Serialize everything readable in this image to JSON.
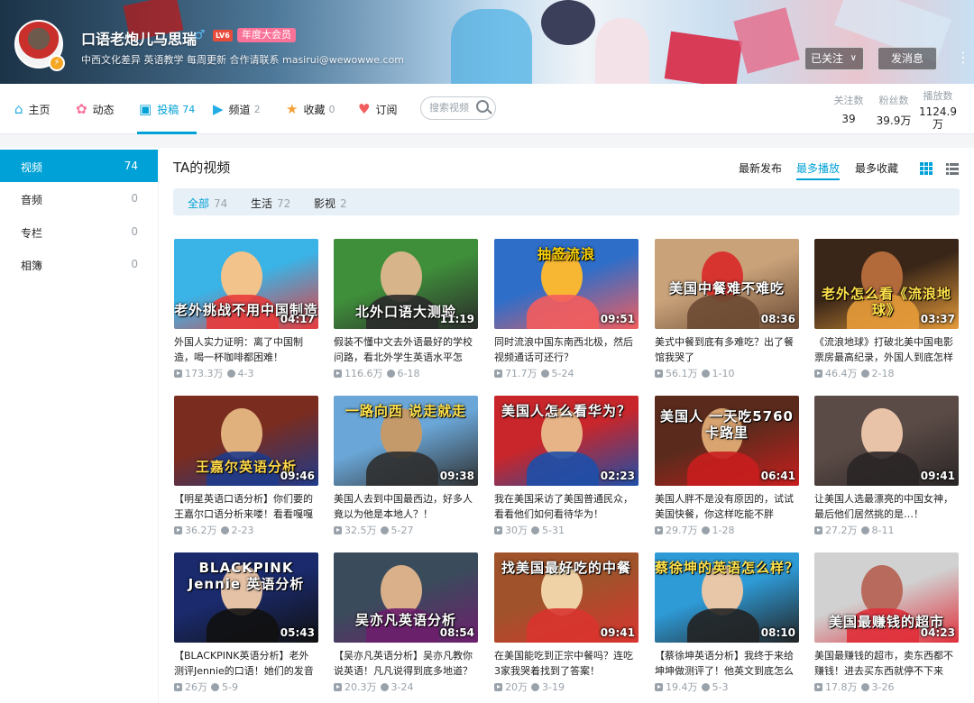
{
  "colors": {
    "accent": "#00a1d6",
    "vip": "#fb7299",
    "muted": "#99a2aa"
  },
  "header": {
    "username": "口语老炮儿马思瑞",
    "gender_icon": "male-icon",
    "level_badge": "LV6",
    "vip_badge": "年度大会员",
    "signature": "中西文化差异 英语教学 每周更新 合作请联系 masirui@wewowwe.com",
    "follow_button": "已关注",
    "message_button": "发消息",
    "more_icon": "more-vertical-icon"
  },
  "nav": {
    "items": [
      {
        "label": "主页",
        "count": "",
        "icon": "home-icon"
      },
      {
        "label": "动态",
        "count": "",
        "icon": "flower-icon"
      },
      {
        "label": "投稿",
        "count": "74",
        "icon": "video-icon"
      },
      {
        "label": "频道",
        "count": "2",
        "icon": "channel-icon"
      },
      {
        "label": "收藏",
        "count": "0",
        "icon": "star-icon"
      },
      {
        "label": "订阅",
        "count": "",
        "icon": "heart-icon"
      }
    ],
    "search_placeholder": "搜索视频",
    "stats": [
      {
        "label": "关注数",
        "value": "39"
      },
      {
        "label": "粉丝数",
        "value": "39.9万"
      },
      {
        "label": "播放数",
        "value": "1124.9万"
      }
    ]
  },
  "sidebar": {
    "items": [
      {
        "label": "视频",
        "count": "74"
      },
      {
        "label": "音频",
        "count": "0"
      },
      {
        "label": "专栏",
        "count": "0"
      },
      {
        "label": "相簿",
        "count": "0"
      }
    ]
  },
  "main": {
    "title": "TA的视频",
    "sort": [
      "最新发布",
      "最多播放",
      "最多收藏"
    ],
    "filters": [
      {
        "label": "全部",
        "count": "74"
      },
      {
        "label": "生活",
        "count": "72"
      },
      {
        "label": "影视",
        "count": "2"
      }
    ]
  },
  "videos": [
    {
      "overlay": "老外挑战不用中国制造",
      "duration": "04:17",
      "title": "外国人实力证明：离了中国制造，喝一杯咖啡都困难！",
      "views": "173.3万",
      "date": "4-3"
    },
    {
      "overlay": "北外口语大测验",
      "duration": "11:19",
      "title": "假装不懂中文去外语最好的学校问路，看北外学生英语水平怎",
      "views": "116.6万",
      "date": "6-18"
    },
    {
      "overlay": "抽签流浪",
      "duration": "09:51",
      "title": "同时流浪中国东南西北极，然后视频通话可还行？",
      "views": "71.7万",
      "date": "5-24"
    },
    {
      "overlay": "美国中餐难不难吃",
      "duration": "08:36",
      "title": "美式中餐到底有多难吃？出了餐馆我哭了",
      "views": "56.1万",
      "date": "1-10"
    },
    {
      "overlay": "老外怎么看《流浪地球》",
      "duration": "03:37",
      "title": "《流浪地球》打破北美中国电影票房最高纪录，外国人到底怎样",
      "views": "46.4万",
      "date": "2-18"
    },
    {
      "overlay": "王嘉尔英语分析",
      "duration": "09:46",
      "title": "【明星英语口语分析】你们要的王嘉尔口语分析来喽！看看嘎嘎",
      "views": "36.2万",
      "date": "2-23"
    },
    {
      "overlay": "一路向西 说走就走",
      "duration": "09:38",
      "title": "美国人去到中国最西边，好多人竟以为他是本地人？！",
      "views": "32.5万",
      "date": "5-27"
    },
    {
      "overlay": "美国人怎么看华为？",
      "duration": "02:23",
      "title": "我在美国采访了美国普通民众，看看他们如何看待华为！",
      "views": "30万",
      "date": "5-31"
    },
    {
      "overlay": "美国人 一天吃5760卡路里",
      "duration": "06:41",
      "title": "美国人胖不是没有原因的，试试美国快餐，你这样吃能不胖",
      "views": "29.7万",
      "date": "1-28"
    },
    {
      "overlay": "",
      "duration": "09:41",
      "title": "让美国人选最漂亮的中国女神，最后他们居然挑的是…！",
      "views": "27.2万",
      "date": "8-11"
    },
    {
      "overlay": "BLACKPINK Jennie 英语分析",
      "duration": "05:43",
      "title": "【BLACKPINK英语分析】老外测评Jennie的口语！她们的发音",
      "views": "26万",
      "date": "5-9"
    },
    {
      "overlay": "吴亦凡英语分析",
      "duration": "08:54",
      "title": "【吴亦凡英语分析】吴亦凡教你说英语！凡凡说得到底多地道？",
      "views": "20.3万",
      "date": "3-24"
    },
    {
      "overlay": "找美国最好吃的中餐",
      "duration": "09:41",
      "title": "在美国能吃到正宗中餐吗？连吃3家我哭着找到了答案！",
      "views": "20万",
      "date": "3-19"
    },
    {
      "overlay": "蔡徐坤的英语怎么样？",
      "duration": "08:10",
      "title": "【蔡徐坤英语分析】我终于来给坤坤做测评了！他英文到底怎么",
      "views": "19.4万",
      "date": "5-3"
    },
    {
      "overlay": "美国最赚钱的超市",
      "duration": "04:23",
      "title": "美国最赚钱的超市，卖东西都不赚钱！进去买东西就停不下来",
      "views": "17.8万",
      "date": "3-26"
    }
  ]
}
